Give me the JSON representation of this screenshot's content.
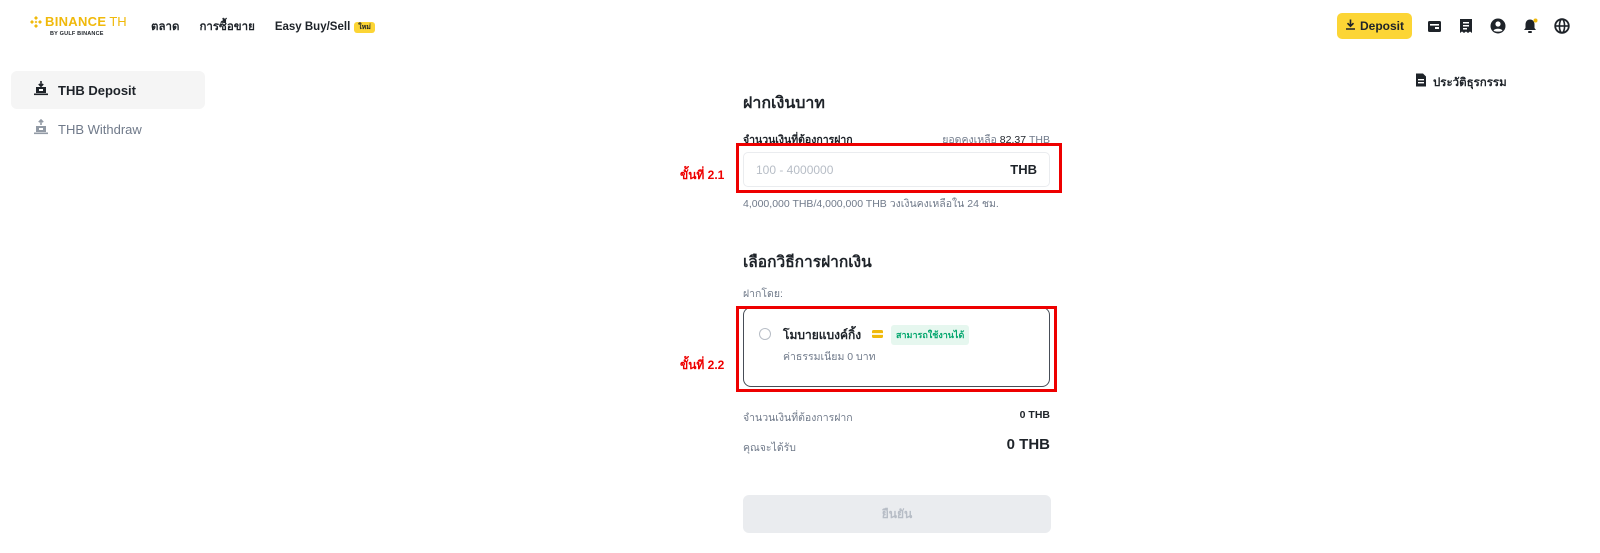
{
  "header": {
    "logo": {
      "brand": "BINANCE",
      "suffix": "TH",
      "sub": "BY GULF BINANCE"
    },
    "nav": [
      {
        "label": "ตลาด"
      },
      {
        "label": "การซื้อขาย"
      },
      {
        "label": "Easy Buy/Sell",
        "badge": "ใหม่"
      }
    ],
    "deposit_button": "Deposit",
    "icons": [
      "wallet-icon",
      "receipt-icon",
      "user-icon",
      "bell-icon",
      "globe-icon"
    ]
  },
  "sidebar": {
    "items": [
      {
        "label": "THB Deposit",
        "active": true
      },
      {
        "label": "THB Withdraw",
        "active": false
      }
    ]
  },
  "history": {
    "label": "ประวัติธุรกรรม"
  },
  "form": {
    "title": "ฝากเงินบาท",
    "amount_label": "จำนวนเงินที่ต้องการฝาก",
    "balance_prefix": "ยอดคงเหลือ",
    "balance_value": "82.37",
    "balance_unit": "THB",
    "input_placeholder": "100 - 4000000",
    "input_unit": "THB",
    "limit_text": "4,000,000 THB/4,000,000 THB วงเงินคงเหลือใน 24 ชม."
  },
  "method": {
    "title": "เลือกวิธีการฝากเงิน",
    "sub": "ฝากโดย:",
    "option": {
      "name": "โมบายแบงค์กิ้ง",
      "badge": "สามารถใช้งานได้",
      "fee": "ค่าธรรมเนียม 0 บาท",
      "selected": false
    }
  },
  "summary": {
    "amount_label": "จำนวนเงินที่ต้องการฝาก",
    "amount_value": "0 THB",
    "receive_label": "คุณจะได้รับ",
    "receive_value": "0 THB"
  },
  "confirm_button": "ยืนยัน",
  "annotations": {
    "step1": "ขั้นที่ 2.1",
    "step2": "ขั้นที่ 2.2"
  },
  "colors": {
    "accent": "#fcd535",
    "brand": "#f0b90b",
    "annotation": "#ee0000",
    "success": "#03a66d"
  }
}
